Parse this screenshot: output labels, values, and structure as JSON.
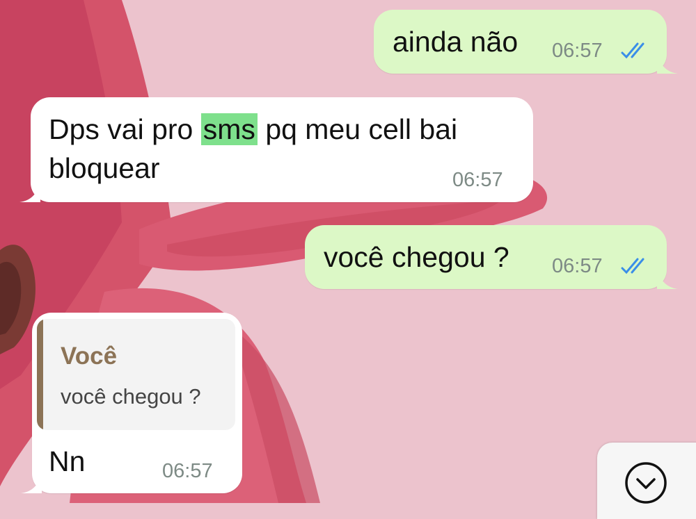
{
  "messages": [
    {
      "direction": "outgoing",
      "text": "ainda não",
      "time": "06:57",
      "read": true
    },
    {
      "direction": "incoming",
      "text_before": "Dps vai pro ",
      "highlight": "sms",
      "text_after": " pq meu cell bai",
      "text_line2": "bloquear",
      "time": "06:57"
    },
    {
      "direction": "outgoing",
      "text": "você chegou ?",
      "time": "06:57",
      "read": true
    },
    {
      "direction": "incoming",
      "reply": {
        "author": "Você",
        "text": "você chegou ?"
      },
      "text": "Nn",
      "time": "06:57"
    }
  ],
  "colors": {
    "outgoing_bubble": "#dcf8c6",
    "incoming_bubble": "#ffffff",
    "highlight": "#7ee08c",
    "read_ticks": "#3a8ee8",
    "reply_accent": "#8c7356",
    "wallpaper": "#ecc3cd"
  },
  "icons": {
    "read_receipt": "double-check-icon",
    "scroll_down": "chevron-down-circle-icon"
  }
}
